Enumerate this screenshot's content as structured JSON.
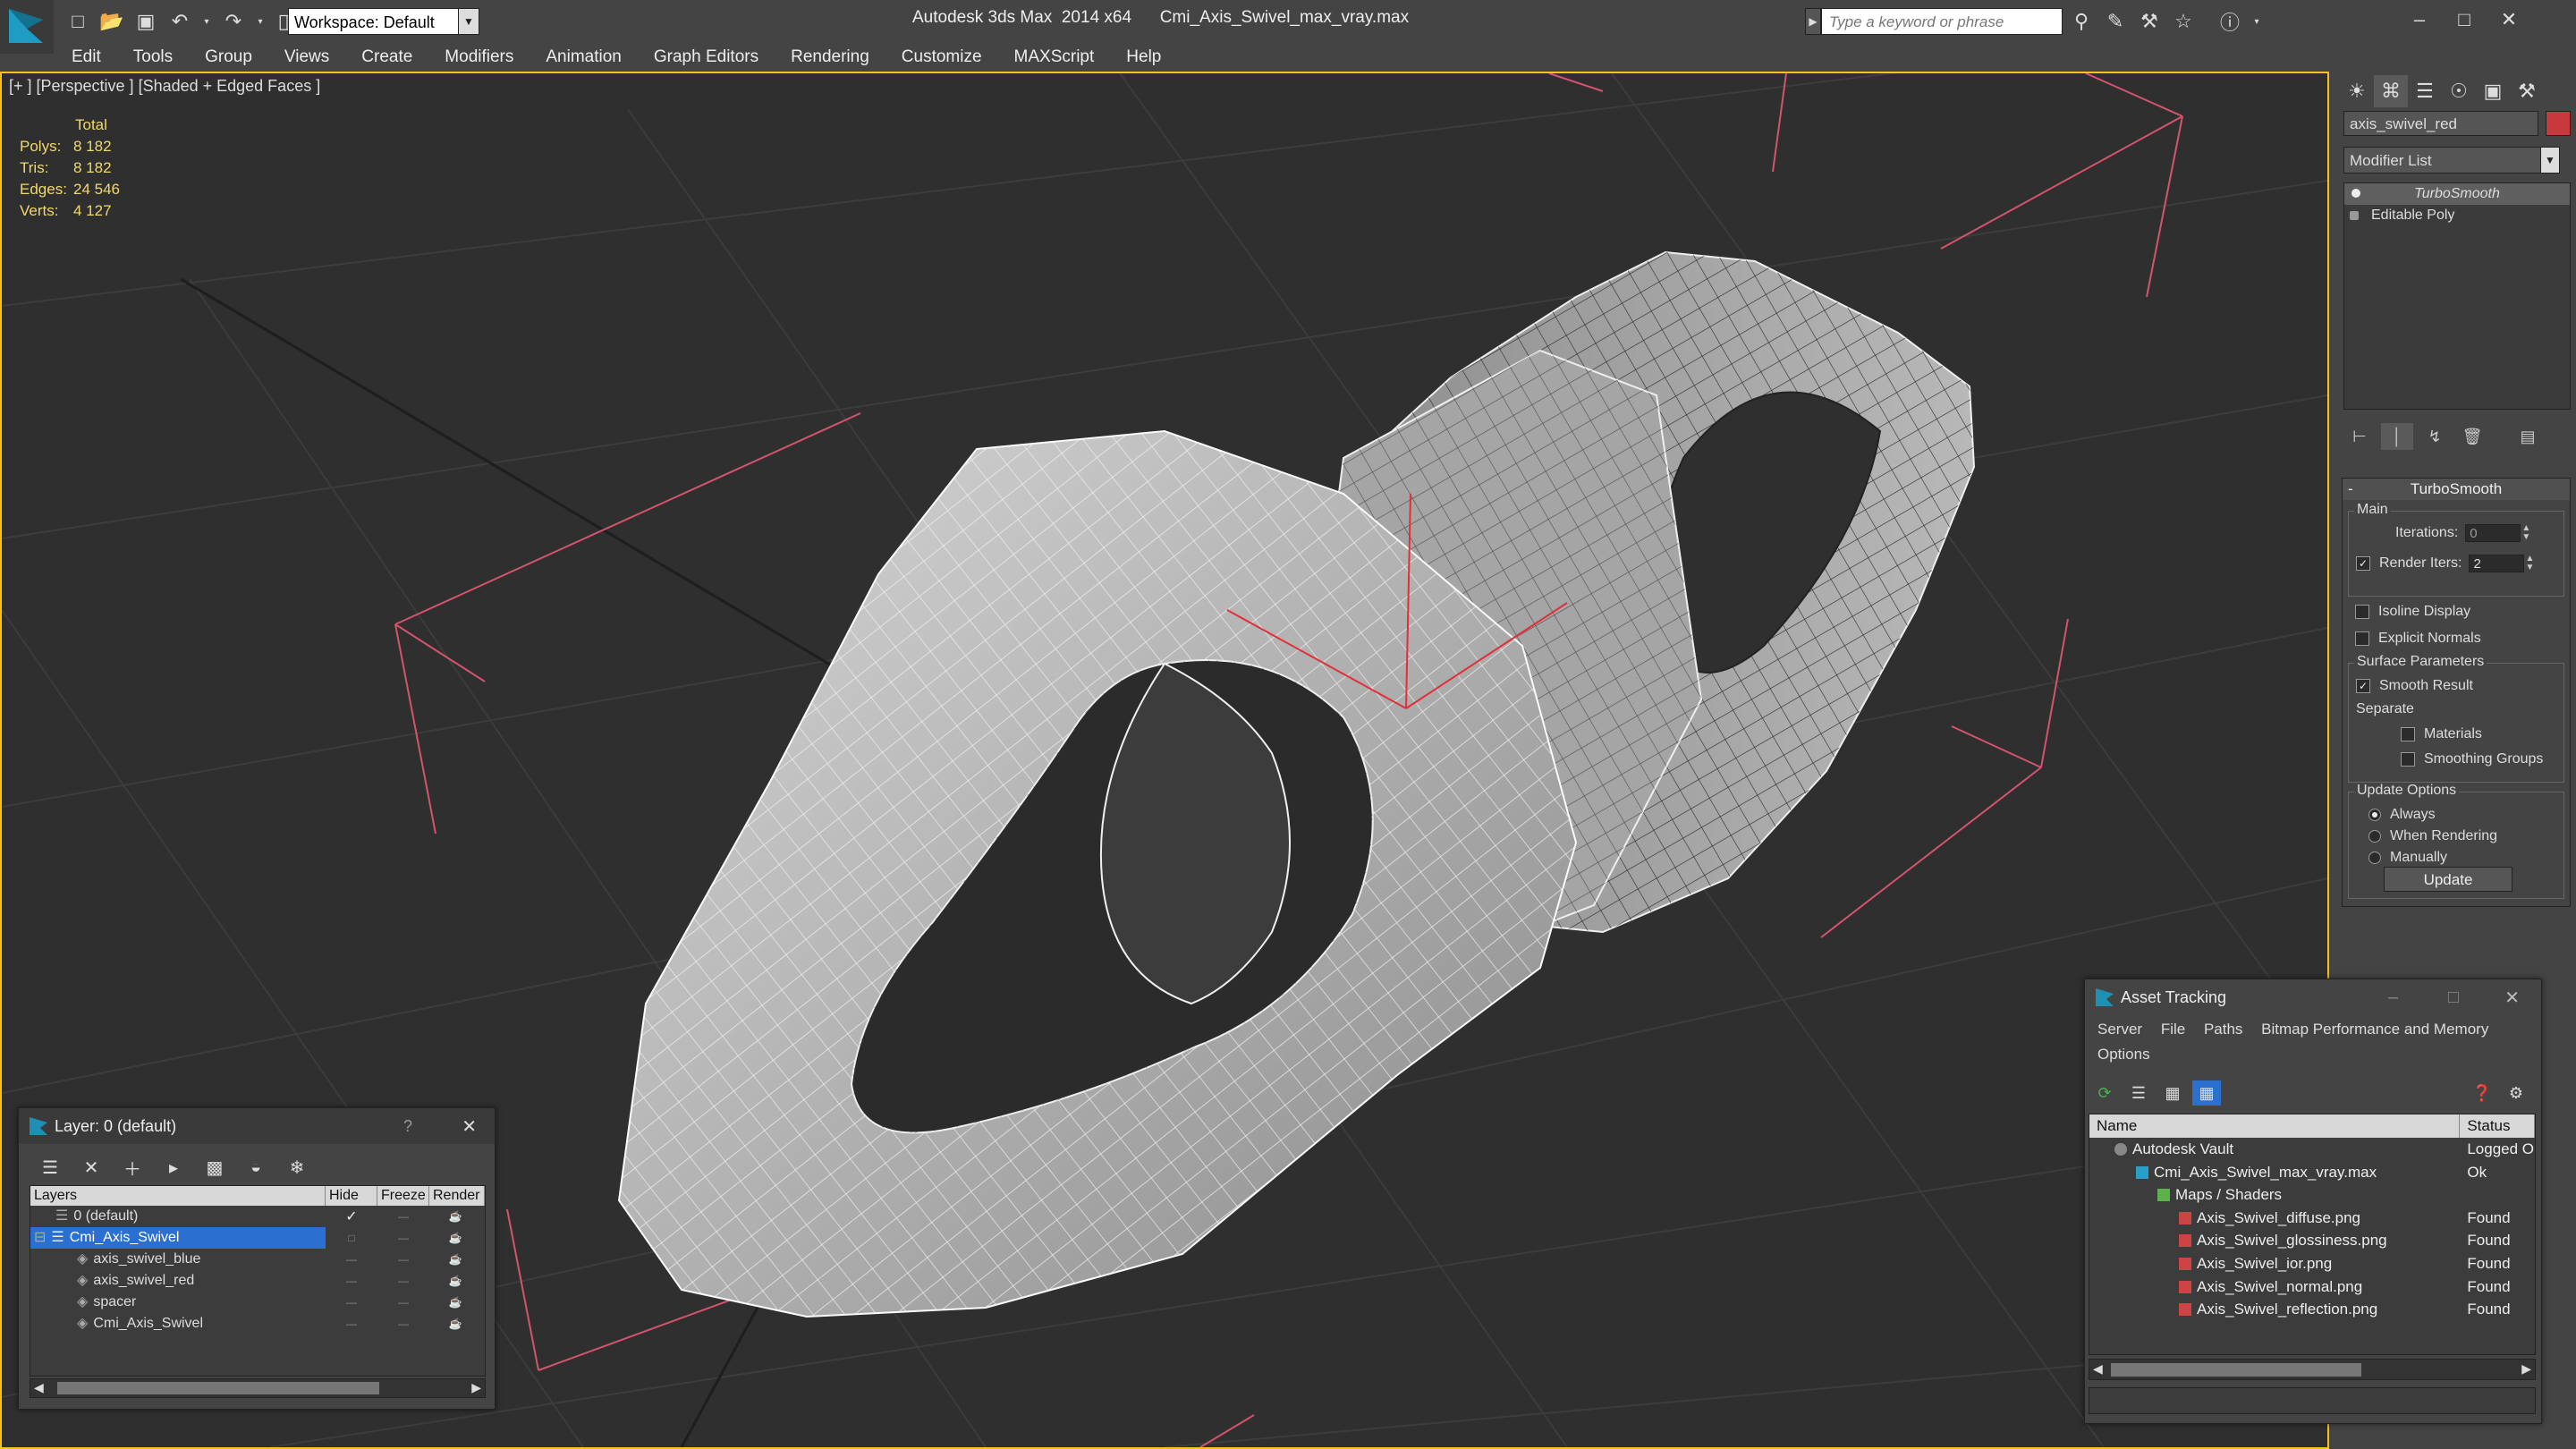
{
  "app": {
    "title": "Autodesk 3ds Max  2014 x64      Cmi_Axis_Swivel_max_vray.max",
    "workspace": "Workspace: Default",
    "search_placeholder": "Type a keyword or phrase"
  },
  "menu": [
    "Edit",
    "Tools",
    "Group",
    "Views",
    "Create",
    "Modifiers",
    "Animation",
    "Graph Editors",
    "Rendering",
    "Customize",
    "MAXScript",
    "Help"
  ],
  "viewport": {
    "label": "[+ ] [Perspective ] [Shaded + Edged Faces ]",
    "stats": {
      "header": "Total",
      "polys_label": "Polys:",
      "polys": "8 182",
      "tris_label": "Tris:",
      "tris": "8 182",
      "edges_label": "Edges:",
      "edges": "24 546",
      "verts_label": "Verts:",
      "verts": "4 127"
    }
  },
  "command_panel": {
    "object_name": "axis_swivel_red",
    "object_color": "#c7393c",
    "modifier_list": "Modifier List",
    "stack": [
      "TurboSmooth",
      "Editable Poly"
    ],
    "rollout": {
      "title": "TurboSmooth",
      "main_group": "Main",
      "iterations_label": "Iterations:",
      "iterations": "0",
      "render_iters_label": "Render Iters:",
      "render_iters": "2",
      "isoline_display": "Isoline Display",
      "explicit_normals": "Explicit Normals",
      "surface_group": "Surface Parameters",
      "smooth_result": "Smooth Result",
      "separate_label": "Separate",
      "materials": "Materials",
      "smoothing_groups": "Smoothing Groups",
      "update_group": "Update Options",
      "always": "Always",
      "when_rendering": "When Rendering",
      "manually": "Manually",
      "update_button": "Update"
    }
  },
  "layer_window": {
    "title": "Layer: 0 (default)",
    "help": "?",
    "columns": [
      "Layers",
      "Hide",
      "Freeze",
      "Render"
    ],
    "rows": [
      {
        "name": "0 (default)"
      },
      {
        "name": "Cmi_Axis_Swivel"
      },
      {
        "name": "axis_swivel_blue"
      },
      {
        "name": "axis_swivel_red"
      },
      {
        "name": "spacer"
      },
      {
        "name": "Cmi_Axis_Swivel"
      }
    ]
  },
  "asset_window": {
    "title": "Asset Tracking",
    "menu": [
      "Server",
      "File",
      "Paths",
      "Bitmap Performance and Memory",
      "Options"
    ],
    "columns": [
      "Name",
      "Status"
    ],
    "rows": [
      {
        "name": "Autodesk Vault",
        "status": "Logged O"
      },
      {
        "name": "Cmi_Axis_Swivel_max_vray.max",
        "status": "Ok"
      },
      {
        "name": "Maps / Shaders",
        "status": ""
      },
      {
        "name": "Axis_Swivel_diffuse.png",
        "status": "Found"
      },
      {
        "name": "Axis_Swivel_glossiness.png",
        "status": "Found"
      },
      {
        "name": "Axis_Swivel_ior.png",
        "status": "Found"
      },
      {
        "name": "Axis_Swivel_normal.png",
        "status": "Found"
      },
      {
        "name": "Axis_Swivel_reflection.png",
        "status": "Found"
      }
    ]
  }
}
